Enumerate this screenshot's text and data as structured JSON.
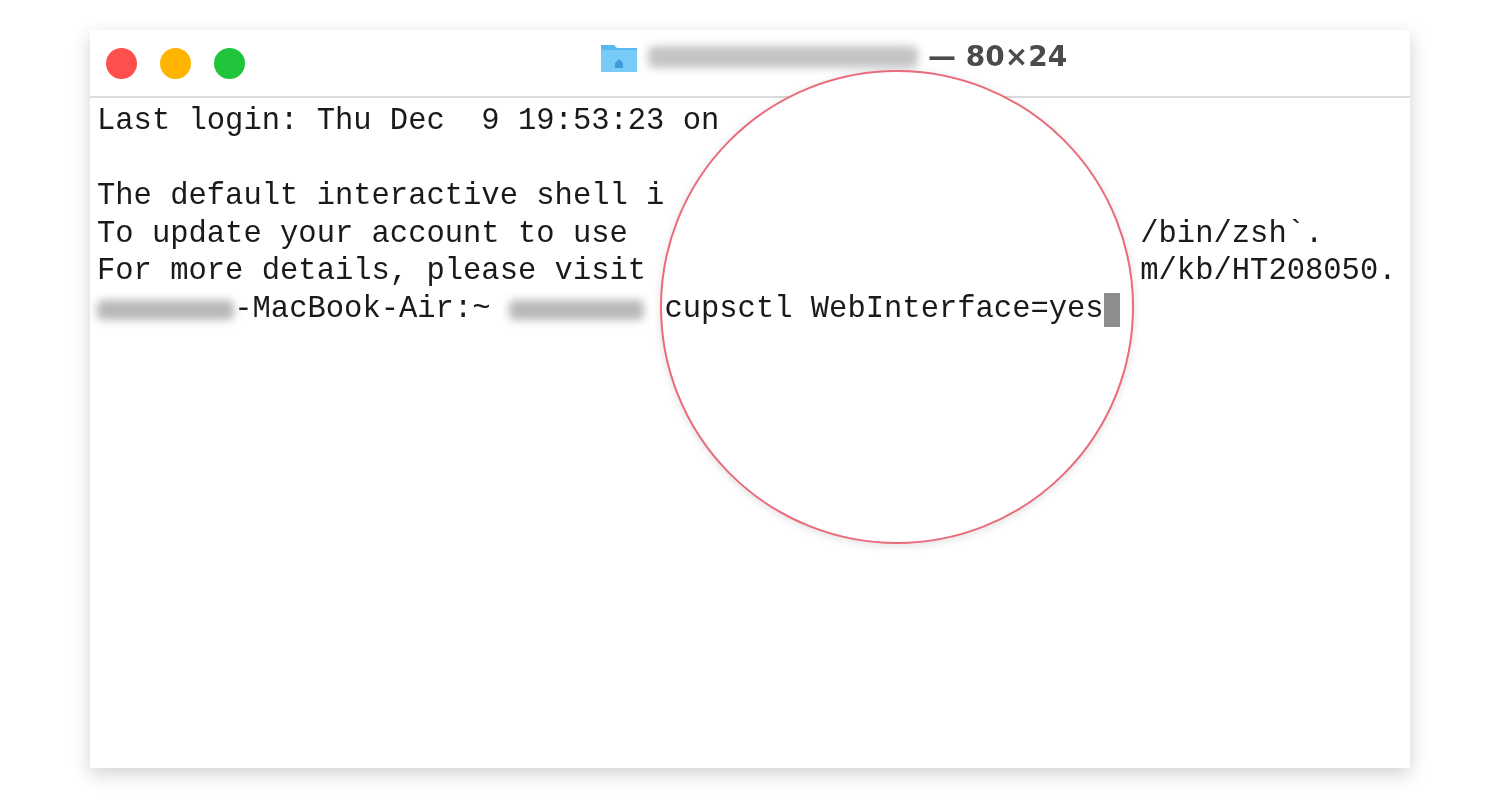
{
  "window": {
    "title": "— 80×24",
    "controls": [
      {
        "kind": "close"
      },
      {
        "kind": "minimize"
      },
      {
        "kind": "zoom"
      }
    ]
  },
  "terminal": {
    "lines": [
      {
        "kind": "text",
        "text": "Last login: Thu Dec  9 19:53:23 on"
      },
      {
        "kind": "blank"
      },
      {
        "kind": "text",
        "text": "The default interactive shell i"
      },
      {
        "kind": "text",
        "text": "To update your account to use",
        "right": "/bin/zsh`."
      },
      {
        "kind": "text",
        "text": "For more details, please visit",
        "right": "m/kb/HT208050."
      },
      {
        "kind": "prompt",
        "host": "-MacBook-Air:~",
        "command": "cupsctl WebInterface=yes",
        "cursor": true
      }
    ]
  }
}
